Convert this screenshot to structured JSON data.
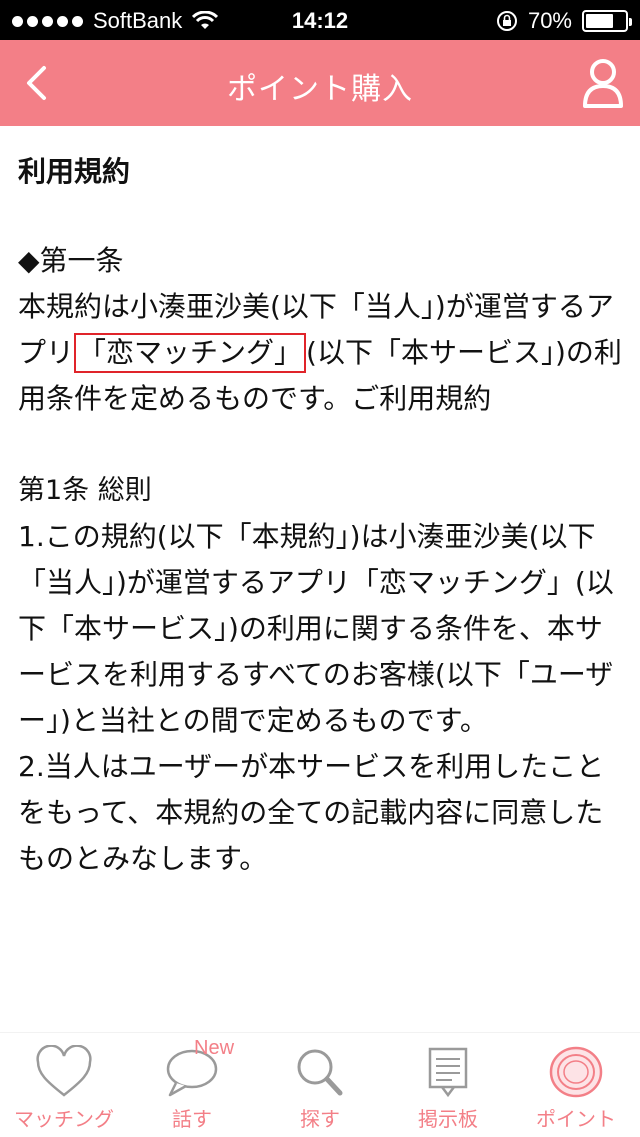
{
  "status_bar": {
    "carrier": "SoftBank",
    "time": "14:12",
    "battery_text": "70%",
    "battery_level": 0.7
  },
  "nav": {
    "title": "ポイント購入"
  },
  "content": {
    "heading": "利用規約",
    "preamble_title": "◆第一条",
    "preamble_before": "本規約は小湊亜沙美(以下「当人」)が運営するアプリ",
    "preamble_highlight": "「恋マッチング」",
    "preamble_after": "(以下「本サービス」)の利用条件を定めるものです。ご利用規約",
    "article1_title": "第1条 総則",
    "clause1": "1.この規約(以下「本規約」)は小湊亜沙美(以下「当人」)が運営するアプリ「恋マッチング」(以下「本サービス」)の利用に関する条件を、本サービスを利用するすべてのお客様(以下「ユーザー」)と当社との間で定めるものです。",
    "clause2": "2.当人はユーザーが本サービスを利用したことをもって、本規約の全ての記載内容に同意したものとみなします。"
  },
  "tabs": [
    {
      "label": "マッチング",
      "icon": "heart-icon"
    },
    {
      "label": "話す",
      "icon": "speech-bubble-icon",
      "badge": "New"
    },
    {
      "label": "探す",
      "icon": "search-icon"
    },
    {
      "label": "掲示板",
      "icon": "board-icon"
    },
    {
      "label": "ポイント",
      "icon": "coin-icon"
    }
  ],
  "colors": {
    "accent": "#f37f87",
    "highlight_border": "#e0242a",
    "tab_inactive": "#9a9a9a"
  }
}
